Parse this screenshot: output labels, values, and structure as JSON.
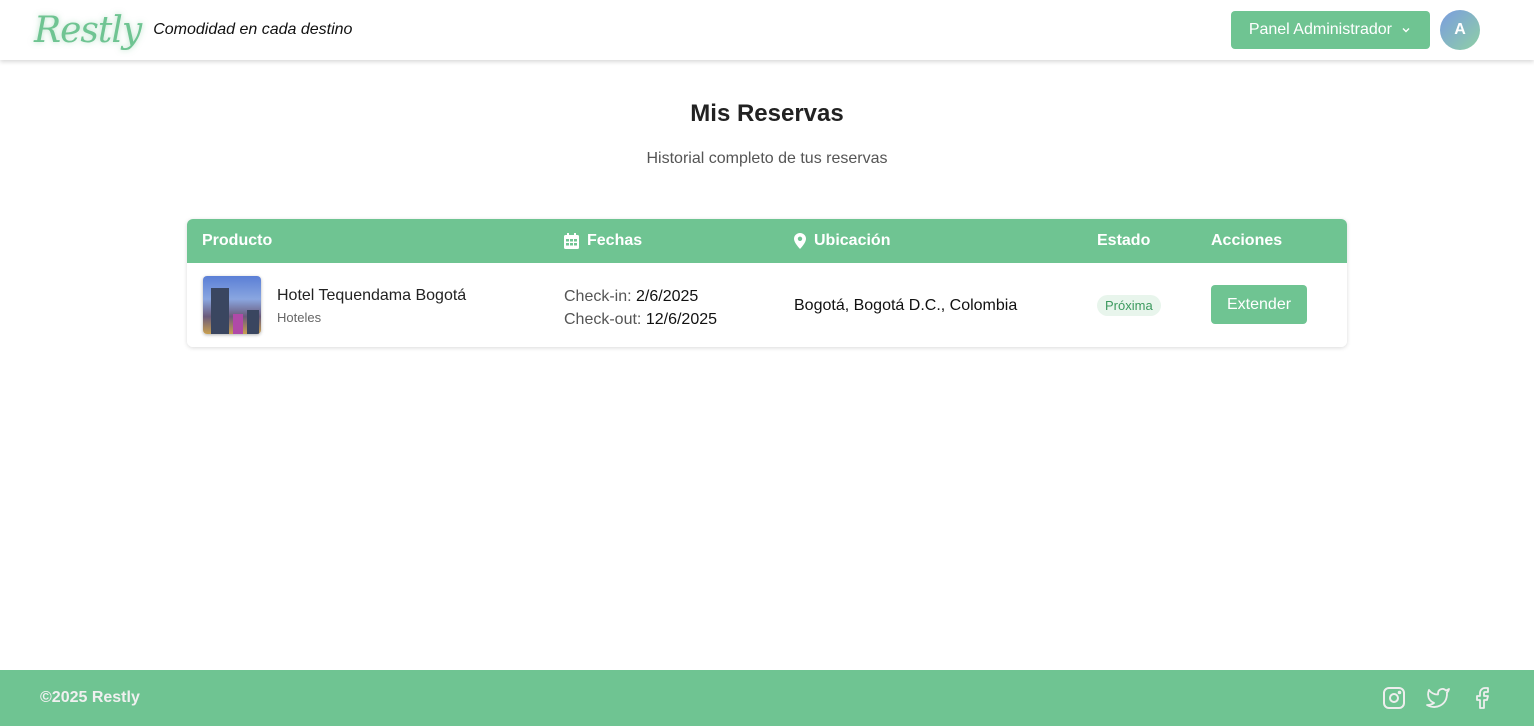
{
  "header": {
    "logo": "Restly",
    "tagline": "Comodidad en cada destino",
    "admin_button": "Panel Administrador",
    "avatar_initial": "A"
  },
  "page": {
    "title": "Mis Reservas",
    "subtitle": "Historial completo de tus reservas"
  },
  "table": {
    "columns": [
      "Producto",
      "Fechas",
      "Ubicación",
      "Estado",
      "Acciones"
    ],
    "rows": [
      {
        "name": "Hotel Tequendama Bogotá",
        "category": "Hoteles",
        "checkin_label": "Check-in:",
        "checkin": "2/6/2025",
        "checkout_label": "Check-out:",
        "checkout": "12/6/2025",
        "location": "Bogotá, Bogotá D.C., Colombia",
        "status": "Próxima",
        "action": "Extender"
      }
    ]
  },
  "footer": {
    "copyright": "©2025 Restly",
    "social": [
      "instagram-icon",
      "twitter-icon",
      "facebook-icon"
    ]
  },
  "colors": {
    "accent": "#6fc492"
  }
}
